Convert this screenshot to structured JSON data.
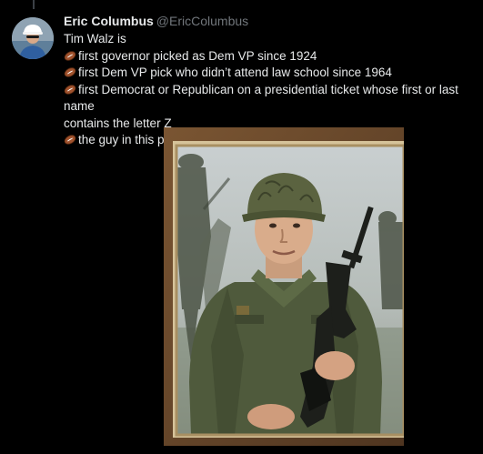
{
  "author": {
    "display_name": "Eric Columbus",
    "handle": "@EricColumbus"
  },
  "tweet": {
    "lines": [
      "Tim Walz is",
      "first governor picked as Dem VP since 1924",
      "first Dem VP pick who didn’t attend law school since 1964",
      "first Democrat or Republican on a presidential ticket whose first or last name",
      "contains the letter Z",
      "the guy in this picture"
    ]
  },
  "icons": {
    "bullet": "american-football-icon",
    "avatar": "avatar-photo-hard-hat",
    "photo": "framed-military-portrait-photo"
  },
  "colors": {
    "background": "#000000",
    "name": "#e7e9ea",
    "handle": "#71767b",
    "text": "#e7e9ea",
    "frame": "#6a4a2c"
  }
}
